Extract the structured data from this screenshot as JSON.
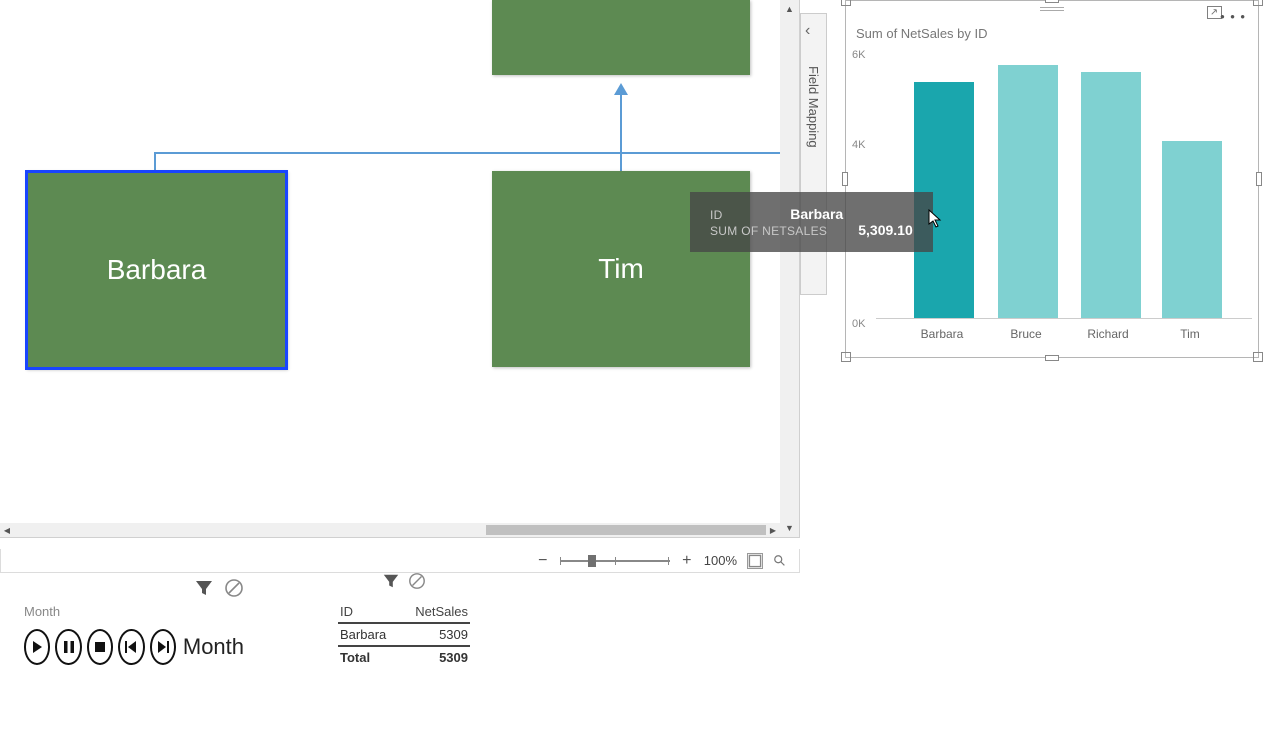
{
  "canvas": {
    "nodes": {
      "barbara": "Barbara",
      "tim": "Tim"
    }
  },
  "fieldmap": {
    "label": "Field Mapping"
  },
  "zoom": {
    "level": "100%"
  },
  "chart": {
    "title": "Sum of NetSales by ID",
    "y_axis": {
      "t0": "0K",
      "t1": "4K",
      "t2": "6K"
    }
  },
  "chart_data": {
    "type": "bar",
    "title": "Sum of NetSales by ID",
    "xlabel": "ID",
    "ylabel": "Sum of NetSales",
    "ylim": [
      0,
      6000
    ],
    "categories": [
      "Barbara",
      "Bruce",
      "Richard",
      "Tim"
    ],
    "values": [
      5309.1,
      5700,
      5550,
      4000
    ]
  },
  "tooltip": {
    "id_label": "ID",
    "id_value": "Barbara",
    "sum_label": "SUM OF NETSALES",
    "sum_value": "5,309.10"
  },
  "player": {
    "field": "Month",
    "display": "Month"
  },
  "table": {
    "cols": {
      "id": "ID",
      "net": "NetSales"
    },
    "rows": [
      {
        "id": "Barbara",
        "net": "5309"
      }
    ],
    "total_label": "Total",
    "total_value": "5309"
  }
}
